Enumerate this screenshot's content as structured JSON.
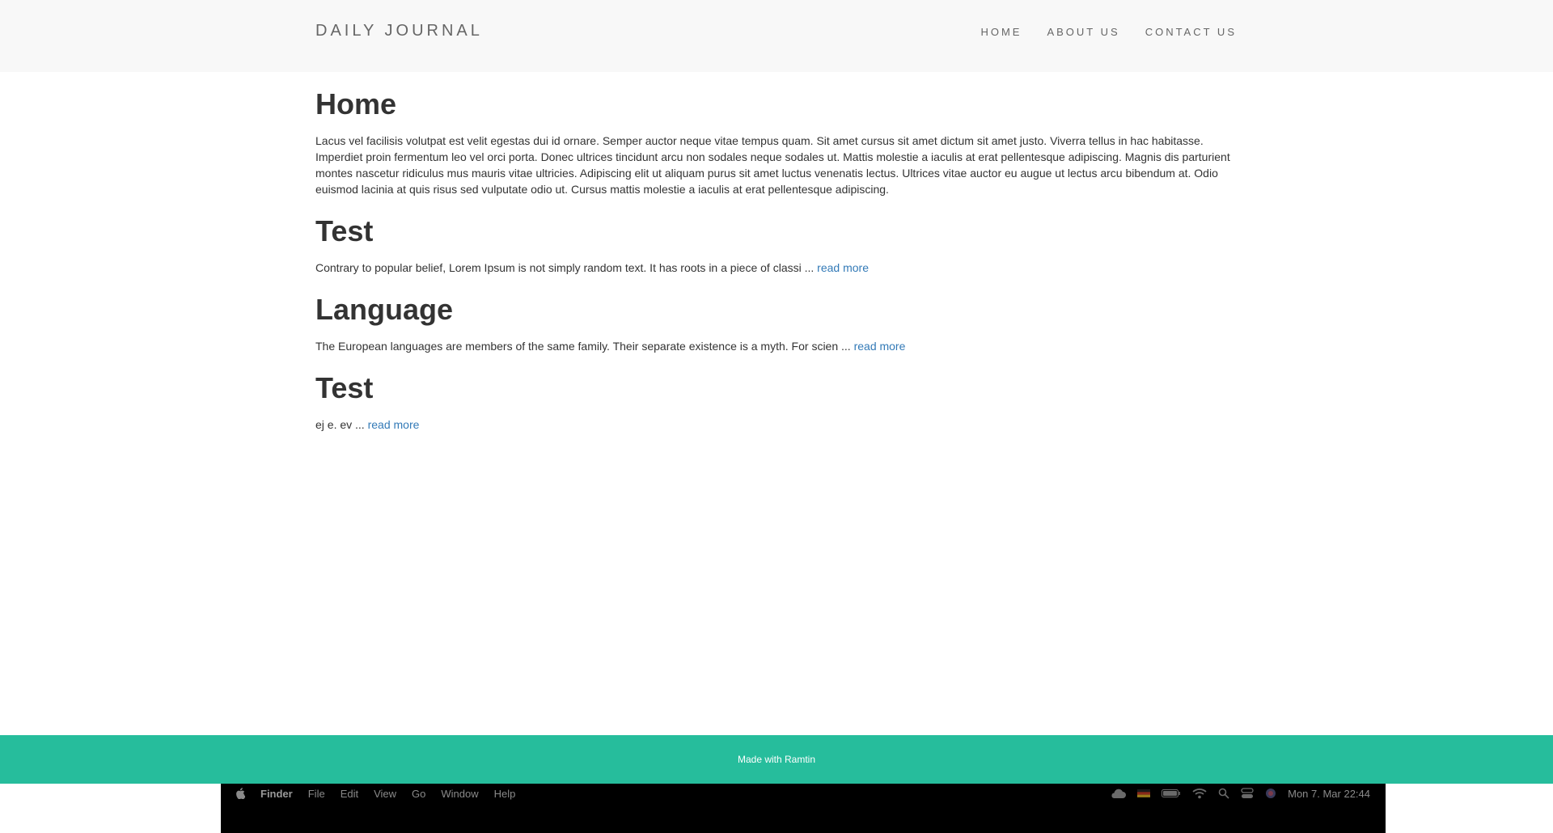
{
  "navbar": {
    "brand": "DAILY JOURNAL",
    "links": [
      "HOME",
      "ABOUT US",
      "CONTACT US"
    ]
  },
  "posts": [
    {
      "title": "Home",
      "body": "Lacus vel facilisis volutpat est velit egestas dui id ornare. Semper auctor neque vitae tempus quam. Sit amet cursus sit amet dictum sit amet justo. Viverra tellus in hac habitasse. Imperdiet proin fermentum leo vel orci porta. Donec ultrices tincidunt arcu non sodales neque sodales ut. Mattis molestie a iaculis at erat pellentesque adipiscing. Magnis dis parturient montes nascetur ridiculus mus mauris vitae ultricies. Adipiscing elit ut aliquam purus sit amet luctus venenatis lectus. Ultrices vitae auctor eu augue ut lectus arcu bibendum at. Odio euismod lacinia at quis risus sed vulputate odio ut. Cursus mattis molestie a iaculis at erat pellentesque adipiscing."
    },
    {
      "title": "Test",
      "excerpt": "Contrary to popular belief, Lorem Ipsum is not simply random text. It has roots in a piece of classi ...",
      "read_more": "read more"
    },
    {
      "title": "Language",
      "excerpt": "The European languages are members of the same family. Their separate existence is a myth. For scien ...",
      "read_more": "read more"
    },
    {
      "title": "Test",
      "excerpt": "ej e. ev ...",
      "read_more": "read more"
    }
  ],
  "footer": {
    "text": "Made with Ramtin",
    "color": "#26bd9c"
  },
  "menubar": {
    "app": "Finder",
    "menus": [
      "File",
      "Edit",
      "View",
      "Go",
      "Window",
      "Help"
    ],
    "status_icons": [
      "cloud-icon",
      "flag-icon",
      "battery-icon",
      "wifi-icon",
      "spotlight-icon",
      "control-center-icon",
      "siri-icon"
    ],
    "clock": "Mon 7. Mar  22:44"
  },
  "colors": {
    "link": "#337ab7",
    "navbar_bg": "#f8f8f8",
    "text": "#333333"
  }
}
